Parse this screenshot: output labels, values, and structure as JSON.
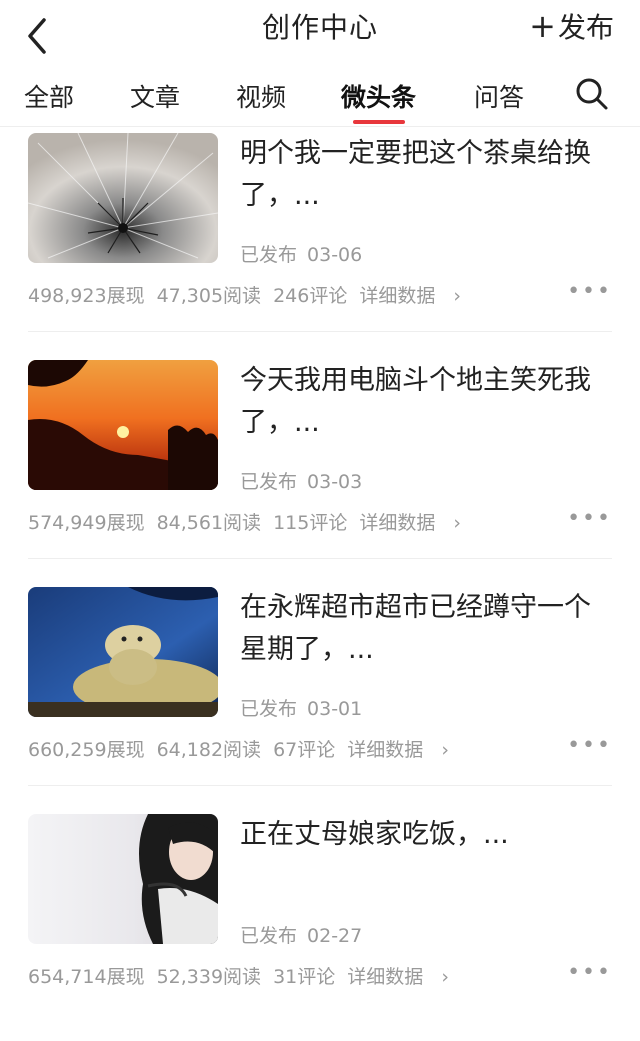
{
  "header": {
    "title": "创作中心",
    "publish_label": "发布"
  },
  "tabs": [
    {
      "label": "全部"
    },
    {
      "label": "文章"
    },
    {
      "label": "视频"
    },
    {
      "label": "微头条",
      "active": true
    },
    {
      "label": "问答"
    }
  ],
  "items": [
    {
      "title": "明个我一定要把这个茶桌给换了，...",
      "status": "已发布",
      "date": "03-06",
      "impressions": "498,923展现",
      "reads": "47,305阅读",
      "comments": "246评论",
      "detail": "详细数据"
    },
    {
      "title": "今天我用电脑斗个地主笑死我了，...",
      "status": "已发布",
      "date": "03-03",
      "impressions": "574,949展现",
      "reads": "84,561阅读",
      "comments": "115评论",
      "detail": "详细数据"
    },
    {
      "title": "在永辉超市超市已经蹲守一个星期了，...",
      "status": "已发布",
      "date": "03-01",
      "impressions": "660,259展现",
      "reads": "64,182阅读",
      "comments": "67评论",
      "detail": "详细数据"
    },
    {
      "title": "正在丈母娘家吃饭，...",
      "status": "已发布",
      "date": "02-27",
      "impressions": "654,714展现",
      "reads": "52,339阅读",
      "comments": "31评论",
      "detail": "详细数据"
    }
  ]
}
